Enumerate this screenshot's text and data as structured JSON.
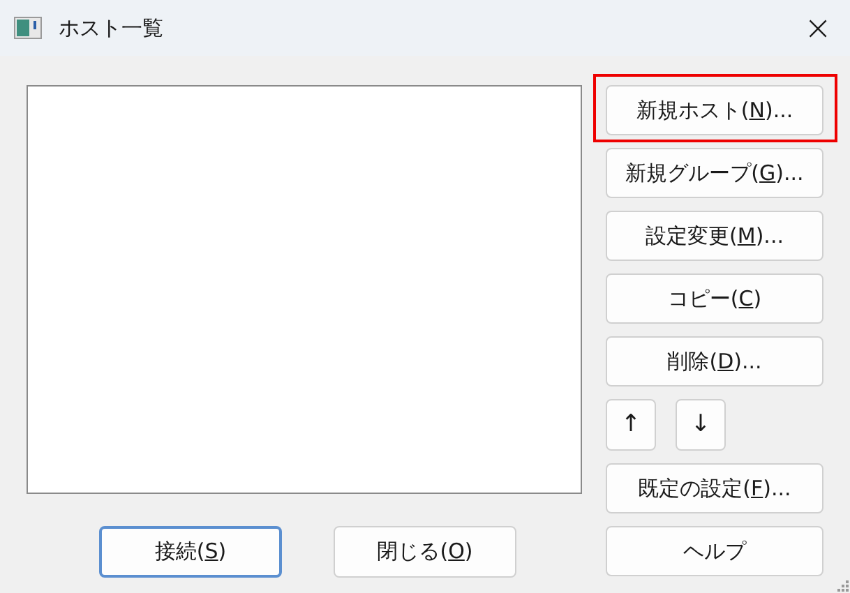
{
  "window": {
    "title": "ホスト一覧",
    "close": "×"
  },
  "side_buttons": [
    {
      "kind": "wide",
      "label": {
        "before": "新規ホスト(",
        "key": "N",
        "after": ")..."
      },
      "highlighted": true
    },
    {
      "kind": "wide",
      "label": {
        "before": "新規グループ(",
        "key": "G",
        "after": ")..."
      },
      "highlighted": false
    },
    {
      "kind": "wide",
      "label": {
        "before": "設定変更(",
        "key": "M",
        "after": ")..."
      },
      "highlighted": false
    },
    {
      "kind": "wide",
      "label": {
        "before": "コピー(",
        "key": "C",
        "after": ")"
      },
      "highlighted": false
    },
    {
      "kind": "wide",
      "label": {
        "before": "削除(",
        "key": "D",
        "after": ")..."
      },
      "highlighted": false
    },
    {
      "kind": "arrows",
      "items": [
        "↑",
        "↓"
      ]
    },
    {
      "kind": "wide",
      "label": {
        "before": "既定の設定(",
        "key": "F",
        "after": ")..."
      },
      "highlighted": false
    },
    {
      "kind": "wide",
      "label": {
        "before": "ヘルプ"
      },
      "highlighted": false
    }
  ],
  "bottom_buttons": [
    {
      "label": {
        "before": "接続(",
        "key": "S",
        "after": ")"
      },
      "default": true
    },
    {
      "label": {
        "before": "閉じる(",
        "key": "O",
        "after": ")"
      },
      "default": false
    }
  ]
}
